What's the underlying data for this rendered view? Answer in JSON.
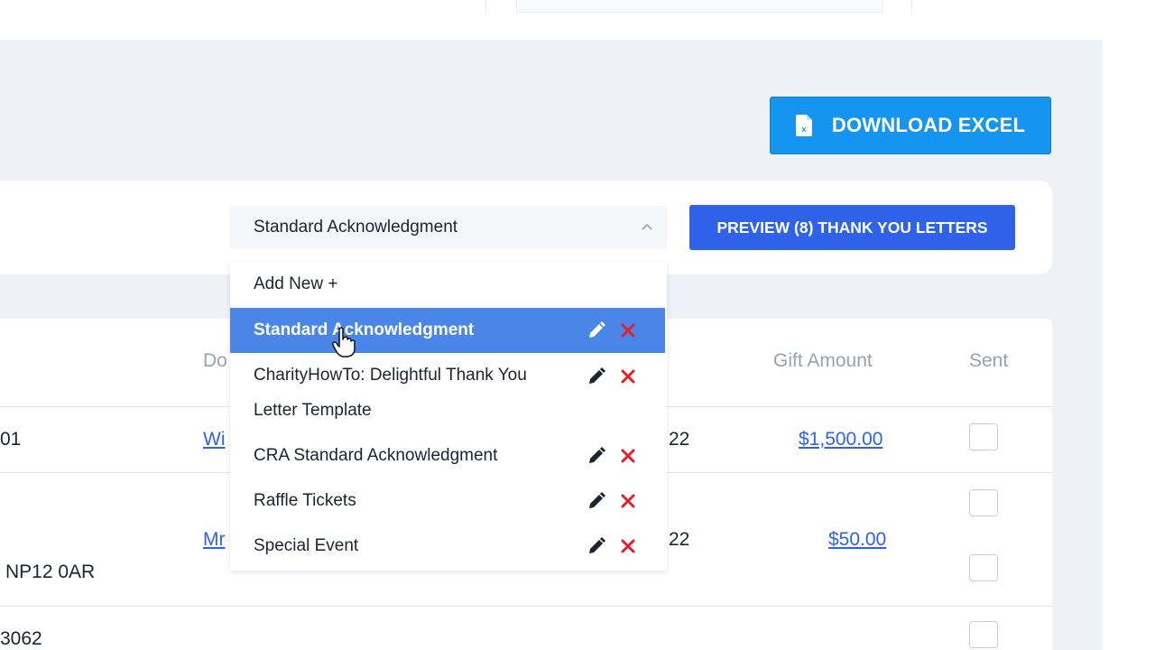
{
  "toolbar": {
    "download_label": "DOWNLOAD EXCEL"
  },
  "template": {
    "selected": "Standard Acknowledgment",
    "preview_label": "PREVIEW (8) THANK YOU LETTERS",
    "menu": [
      {
        "label": "Add New +",
        "editable": false
      },
      {
        "label": "Standard Acknowledgment",
        "highlighted": true
      },
      {
        "label_line1": "CharityHowTo: Delightful Thank You",
        "label_line2": "Letter Template"
      },
      {
        "label": "CRA Standard Acknowledgment"
      },
      {
        "label": "Raffle Tickets"
      },
      {
        "label": "Special Event"
      }
    ]
  },
  "table": {
    "headers": {
      "donor_partial": "Do",
      "gift_amount": "Gift Amount",
      "sent": "Sent"
    },
    "rows": [
      {
        "left_partial": "01",
        "donor_partial": "Wi",
        "date_partial": "22",
        "amount": "$1,500.00"
      },
      {
        "left_partial": "NP12 0AR",
        "donor_partial": "Mr",
        "date_partial": "22",
        "amount": "$50.00"
      },
      {
        "left_partial": "3062"
      }
    ]
  },
  "colors": {
    "excel_button": "#1496f0",
    "preview_button": "#2f62e8",
    "highlight": "#4a86e8",
    "delete": "#e0202a",
    "link": "#2f62e8"
  },
  "icons": [
    "excel-file-icon",
    "chevron-up-icon",
    "pencil-icon",
    "delete-x-icon",
    "hand-cursor-icon"
  ]
}
